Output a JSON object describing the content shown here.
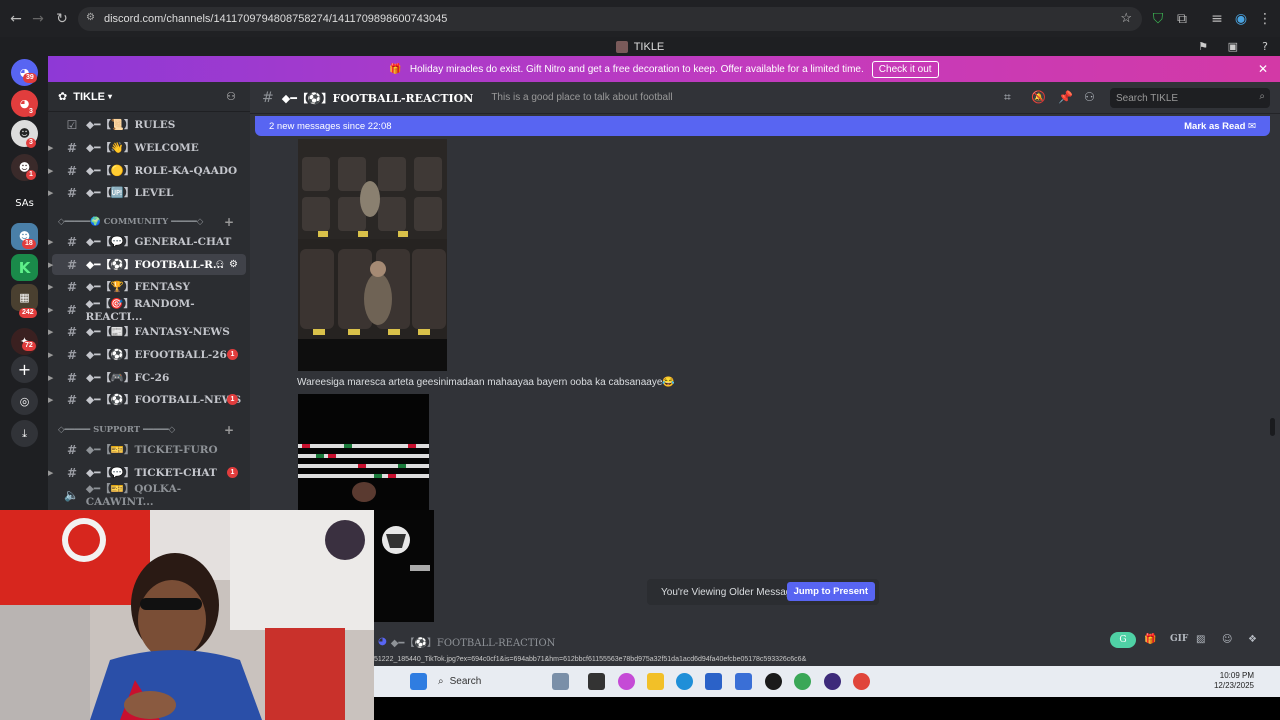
{
  "browser": {
    "url": "discord.com/channels/1411709794808758274/1411709898600743045"
  },
  "app": {
    "title": "TIKLE"
  },
  "servers": [
    {
      "label": "",
      "badge": "39"
    },
    {
      "label": "",
      "badge": "3"
    },
    {
      "label": "",
      "badge": "3"
    },
    {
      "label": "",
      "badge": "1"
    },
    {
      "label": "SAs",
      "badge": ""
    },
    {
      "label": "",
      "badge": "18"
    },
    {
      "label": "K",
      "badge": ""
    },
    {
      "label": "",
      "badge": "242"
    },
    {
      "label": "",
      "badge": "72"
    }
  ],
  "banner": {
    "text": "Holiday miracles do exist. Gift Nitro and get a free decoration to keep. Offer available for a limited time.",
    "button": "Check it out"
  },
  "guild": {
    "name": "TIKLE"
  },
  "channels_top": [
    {
      "name": "◆━【📜】RULES"
    },
    {
      "name": "◆━【👋】WELCOME"
    },
    {
      "name": "◆━【🟡】ROLE-KA-QAADO"
    },
    {
      "name": "◆━【🆙】LEVEL"
    }
  ],
  "category_community": "◇━━━━━🌍 COMMUNITY ━━━━━◇",
  "channels_community": [
    {
      "name": "◆━【💬】GENERAL-CHAT",
      "unread": ""
    },
    {
      "name": "◆━【⚽】FOOTBALL-R...",
      "unread": ""
    },
    {
      "name": "◆━【🏆】FENTASY",
      "unread": ""
    },
    {
      "name": "◆━【🎯】RANDOM-REACTI...",
      "unread": ""
    },
    {
      "name": "◆━【📰】FANTASY-NEWS",
      "unread": ""
    },
    {
      "name": "◆━【⚽】EFOOTBALL-26",
      "unread": "1"
    },
    {
      "name": "◆━【🎮】FC-26",
      "unread": ""
    },
    {
      "name": "◆━【⚽】FOOTBALL-NEWS",
      "unread": "1"
    }
  ],
  "category_support": "◇━━━━━ SUPPORT ━━━━━◇",
  "channels_support": [
    {
      "name": "◆━【🎫】TICKET-FURO",
      "unread": ""
    },
    {
      "name": "◆━【💬】TICKET-CHAT",
      "unread": "1"
    },
    {
      "name": "◆━【🎫】QOLKA-CAAWINT...",
      "unread": ""
    }
  ],
  "channel_header": {
    "name": "◆━【⚽】FOOTBALL-REACTION",
    "topic": "This is a good place to talk about football",
    "search_placeholder": "Search TIKLE"
  },
  "new_messages": {
    "text": "2 new messages since 22:08",
    "mark_read": "Mark as Read"
  },
  "message": {
    "text": "Wareesiga maresca arteta geesinimadaan mahaayaa bayern ooba ka cabsanaaye😂"
  },
  "older_notice": {
    "text": "You're Viewing Older Messages",
    "button": "Jump to Present"
  },
  "composer": {
    "channel": "◆━【⚽】FOOTBALL-REACTION"
  },
  "link_preview": "51222_185440_TikTok.jpg?ex=694c0cf1&is=694abb71&hm=612bbcf61155563e78bd975a32f51da1acd6d94fa40efcbe05178c593326c6c6&",
  "taskbar": {
    "search": "Search",
    "time": "10:09 PM",
    "date": "12/23/2025"
  },
  "colors": {
    "blurple": "#5865f2",
    "unread_red": "#e13d3d",
    "bg_main": "#313338",
    "bg_sidebar": "#2b2d31"
  }
}
